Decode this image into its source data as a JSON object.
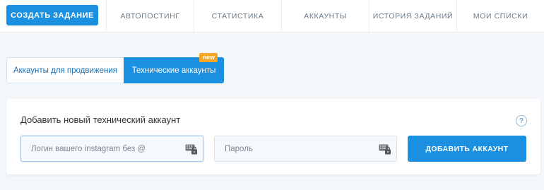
{
  "nav": {
    "create_label": "СОЗДАТЬ ЗАДАНИЕ",
    "tabs": [
      {
        "label": "АВТОПОСТИНГ"
      },
      {
        "label": "СТАТИСТИКА"
      },
      {
        "label": "АККАУНТЫ"
      },
      {
        "label": "ИСТОРИЯ ЗАДАНИЙ"
      },
      {
        "label": "МОИ СПИСКИ"
      }
    ]
  },
  "account_tabs": {
    "promotion_label": "Аккаунты для продвижения",
    "technical_label": "Технические аккаунты",
    "new_badge": "new"
  },
  "form": {
    "title": "Добавить новый технический аккаунт",
    "help_symbol": "?",
    "login_placeholder": "Логин вашего instagram без @",
    "password_placeholder": "Пароль",
    "submit_label": "ДОБАВИТЬ АККАУНТ"
  },
  "colors": {
    "accent": "#1b8fe0",
    "badge": "#f5a623",
    "background": "#f3f7fa"
  },
  "icons": {
    "login_field": "keyboard-lock-icon",
    "password_field": "keyboard-lock-icon",
    "help": "help-circle-icon"
  }
}
